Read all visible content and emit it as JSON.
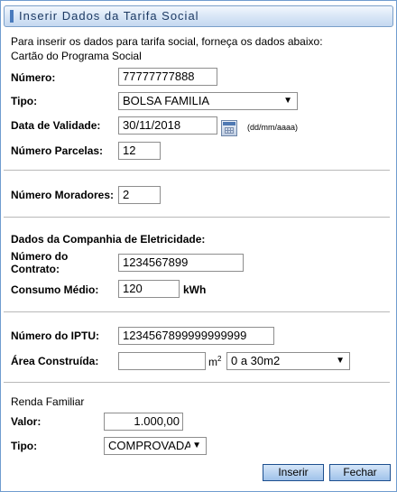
{
  "window": {
    "title": "Inserir Dados da Tarifa Social"
  },
  "intro": "Para inserir os dados para tarifa social, forneça os dados abaixo:",
  "programa": {
    "heading": "Cartão do Programa Social",
    "numero_label": "Número:",
    "numero_value": "77777777888",
    "tipo_label": "Tipo:",
    "tipo_value": "BOLSA FAMILIA",
    "validade_label": "Data de Validade:",
    "validade_value": "30/11/2018",
    "validade_hint": "(dd/mm/aaaa)",
    "parcelas_label": "Número Parcelas:",
    "parcelas_value": "12"
  },
  "moradores": {
    "label": "Número Moradores:",
    "value": "2"
  },
  "eletricidade": {
    "heading": "Dados da Companhia de Eletricidade:",
    "contrato_label_1": "Número do",
    "contrato_label_2": "Contrato:",
    "contrato_value": "1234567899",
    "consumo_label": "Consumo Médio:",
    "consumo_value": "120",
    "consumo_unit": "kWh"
  },
  "imovel": {
    "iptu_label": "Número do IPTU:",
    "iptu_value": "1234567899999999999",
    "area_label": "Área Construída:",
    "area_value": "",
    "area_unit": "m",
    "area_unit_sup": "2",
    "area_faixa": "0 a 30m2"
  },
  "renda": {
    "heading": "Renda Familiar",
    "valor_label": "Valor:",
    "valor_value": "1.000,00",
    "tipo_label": "Tipo:",
    "tipo_value": "COMPROVADA"
  },
  "buttons": {
    "inserir": "Inserir",
    "fechar": "Fechar"
  },
  "icons": {
    "calendar": "calendar-icon",
    "dropdown": "chevron-down-icon"
  },
  "colors": {
    "titlebar": "#c4d8f0",
    "button": "#9fc2ea",
    "border": "#6f9ccf"
  }
}
